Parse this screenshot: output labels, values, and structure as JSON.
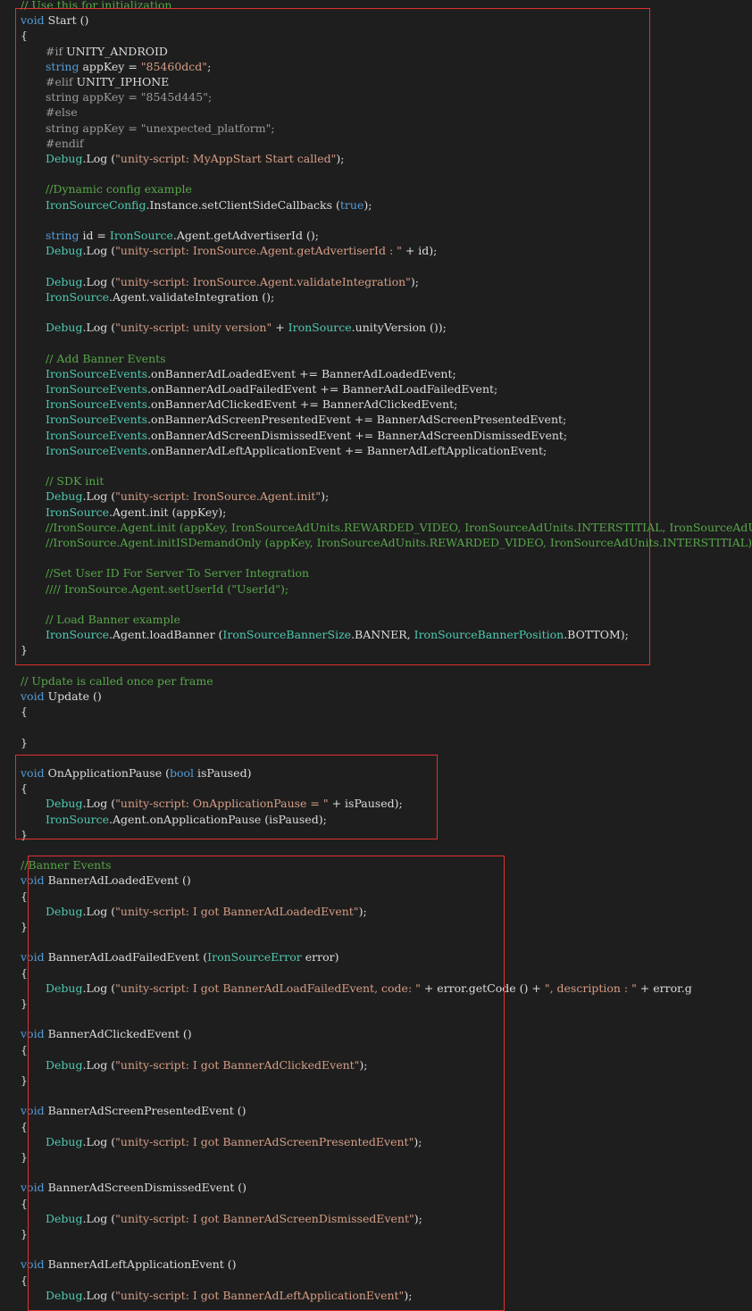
{
  "editor": {
    "colors": {
      "background": "#1e1e1e",
      "keyword": "#569cd6",
      "type": "#4ec9b0",
      "string": "#d69d85",
      "comment": "#57a64a",
      "preprocessor": "#9b9b9b",
      "text": "#dcdcdc",
      "highlight_box": "#e0312f"
    },
    "lines": [
      [
        [
          "cm",
          "// Use this for initialization"
        ]
      ],
      [
        [
          "kw",
          "void"
        ],
        [
          "pl",
          " Start ()"
        ]
      ],
      [
        [
          "pl",
          "{"
        ]
      ],
      [
        [
          "pp",
          "#if"
        ],
        [
          "pl",
          " UNITY_ANDROID"
        ]
      ],
      [
        [
          "kw",
          "string"
        ],
        [
          "pl",
          " appKey = "
        ],
        [
          "str",
          "\"85460dcd\""
        ],
        [
          "pl",
          ";"
        ]
      ],
      [
        [
          "pp",
          "#elif"
        ],
        [
          "pl",
          " UNITY_IPHONE"
        ]
      ],
      [
        [
          "pp",
          "string appKey = \"8545d445\";"
        ]
      ],
      [
        [
          "pp",
          "#else"
        ]
      ],
      [
        [
          "pp",
          "string appKey = \"unexpected_platform\";"
        ]
      ],
      [
        [
          "pp",
          "#endif"
        ]
      ],
      [
        [
          "ty",
          "Debug"
        ],
        [
          "pl",
          ".Log ("
        ],
        [
          "str",
          "\"unity-script: MyAppStart Start called\""
        ],
        [
          "pl",
          ");"
        ]
      ],
      [],
      [
        [
          "cm",
          "//Dynamic config example"
        ]
      ],
      [
        [
          "ty",
          "IronSourceConfig"
        ],
        [
          "pl",
          ".Instance.setClientSideCallbacks ("
        ],
        [
          "kw",
          "true"
        ],
        [
          "pl",
          ");"
        ]
      ],
      [],
      [
        [
          "kw",
          "string"
        ],
        [
          "pl",
          " id = "
        ],
        [
          "ty",
          "IronSource"
        ],
        [
          "pl",
          ".Agent.getAdvertiserId ();"
        ]
      ],
      [
        [
          "ty",
          "Debug"
        ],
        [
          "pl",
          ".Log ("
        ],
        [
          "str",
          "\"unity-script: IronSource.Agent.getAdvertiserId : \""
        ],
        [
          "pl",
          " + id);"
        ]
      ],
      [],
      [
        [
          "ty",
          "Debug"
        ],
        [
          "pl",
          ".Log ("
        ],
        [
          "str",
          "\"unity-script: IronSource.Agent.validateIntegration\""
        ],
        [
          "pl",
          ");"
        ]
      ],
      [
        [
          "ty",
          "IronSource"
        ],
        [
          "pl",
          ".Agent.validateIntegration ();"
        ]
      ],
      [],
      [
        [
          "ty",
          "Debug"
        ],
        [
          "pl",
          ".Log ("
        ],
        [
          "str",
          "\"unity-script: unity version\""
        ],
        [
          "pl",
          " + "
        ],
        [
          "ty",
          "IronSource"
        ],
        [
          "pl",
          ".unityVersion ());"
        ]
      ],
      [],
      [
        [
          "cm",
          "// Add Banner Events"
        ]
      ],
      [
        [
          "ty",
          "IronSourceEvents"
        ],
        [
          "pl",
          ".onBannerAdLoadedEvent += BannerAdLoadedEvent;"
        ]
      ],
      [
        [
          "ty",
          "IronSourceEvents"
        ],
        [
          "pl",
          ".onBannerAdLoadFailedEvent += BannerAdLoadFailedEvent;"
        ]
      ],
      [
        [
          "ty",
          "IronSourceEvents"
        ],
        [
          "pl",
          ".onBannerAdClickedEvent += BannerAdClickedEvent;"
        ]
      ],
      [
        [
          "ty",
          "IronSourceEvents"
        ],
        [
          "pl",
          ".onBannerAdScreenPresentedEvent += BannerAdScreenPresentedEvent;"
        ]
      ],
      [
        [
          "ty",
          "IronSourceEvents"
        ],
        [
          "pl",
          ".onBannerAdScreenDismissedEvent += BannerAdScreenDismissedEvent;"
        ]
      ],
      [
        [
          "ty",
          "IronSourceEvents"
        ],
        [
          "pl",
          ".onBannerAdLeftApplicationEvent += BannerAdLeftApplicationEvent;"
        ]
      ],
      [],
      [
        [
          "cm",
          "// SDK init"
        ]
      ],
      [
        [
          "ty",
          "Debug"
        ],
        [
          "pl",
          ".Log ("
        ],
        [
          "str",
          "\"unity-script: IronSource.Agent.init\""
        ],
        [
          "pl",
          ");"
        ]
      ],
      [
        [
          "ty",
          "IronSource"
        ],
        [
          "pl",
          ".Agent.init (appKey);"
        ]
      ],
      [
        [
          "cm",
          "//IronSource.Agent.init (appKey, IronSourceAdUnits.REWARDED_VIDEO, IronSourceAdUnits.INTERSTITIAL, IronSourceAdUni"
        ]
      ],
      [
        [
          "cm",
          "//IronSource.Agent.initISDemandOnly (appKey, IronSourceAdUnits.REWARDED_VIDEO, IronSourceAdUnits.INTERSTITIAL);"
        ]
      ],
      [],
      [
        [
          "cm",
          "//Set User ID For Server To Server Integration"
        ]
      ],
      [
        [
          "cm",
          "//// IronSource.Agent.setUserId (\"UserId\");"
        ]
      ],
      [],
      [
        [
          "cm",
          "// Load Banner example"
        ]
      ],
      [
        [
          "ty",
          "IronSource"
        ],
        [
          "pl",
          ".Agent.loadBanner ("
        ],
        [
          "ty",
          "IronSourceBannerSize"
        ],
        [
          "pl",
          ".BANNER, "
        ],
        [
          "ty",
          "IronSourceBannerPosition"
        ],
        [
          "pl",
          ".BOTTOM);"
        ]
      ],
      [
        [
          "pl",
          "}"
        ]
      ],
      [],
      [
        [
          "cm",
          "// Update is called once per frame"
        ]
      ],
      [
        [
          "kw",
          "void"
        ],
        [
          "pl",
          " Update ()"
        ]
      ],
      [
        [
          "pl",
          "{"
        ]
      ],
      [],
      [
        [
          "pl",
          "}"
        ]
      ],
      [],
      [
        [
          "kw",
          "void"
        ],
        [
          "pl",
          " OnApplicationPause ("
        ],
        [
          "kw",
          "bool"
        ],
        [
          "pl",
          " isPaused)"
        ]
      ],
      [
        [
          "pl",
          "{"
        ]
      ],
      [
        [
          "ty",
          "Debug"
        ],
        [
          "pl",
          ".Log ("
        ],
        [
          "str",
          "\"unity-script: OnApplicationPause = \""
        ],
        [
          "pl",
          " + isPaused);"
        ]
      ],
      [
        [
          "ty",
          "IronSource"
        ],
        [
          "pl",
          ".Agent.onApplicationPause (isPaused);"
        ]
      ],
      [
        [
          "pl",
          "}"
        ]
      ],
      [],
      [
        [
          "cm",
          "//Banner Events"
        ]
      ],
      [
        [
          "kw",
          "void"
        ],
        [
          "pl",
          " BannerAdLoadedEvent ()"
        ]
      ],
      [
        [
          "pl",
          "{"
        ]
      ],
      [
        [
          "ty",
          "Debug"
        ],
        [
          "pl",
          ".Log ("
        ],
        [
          "str",
          "\"unity-script: I got BannerAdLoadedEvent\""
        ],
        [
          "pl",
          ");"
        ]
      ],
      [
        [
          "pl",
          "}"
        ]
      ],
      [],
      [
        [
          "kw",
          "void"
        ],
        [
          "pl",
          " BannerAdLoadFailedEvent ("
        ],
        [
          "ty",
          "IronSourceError"
        ],
        [
          "pl",
          " error)"
        ]
      ],
      [
        [
          "pl",
          "{"
        ]
      ],
      [
        [
          "ty",
          "Debug"
        ],
        [
          "pl",
          ".Log ("
        ],
        [
          "str",
          "\"unity-script: I got BannerAdLoadFailedEvent, code: \""
        ],
        [
          "pl",
          " + error.getCode () + "
        ],
        [
          "str",
          "\", description : \""
        ],
        [
          "pl",
          " + error.g"
        ]
      ],
      [
        [
          "pl",
          "}"
        ]
      ],
      [],
      [
        [
          "kw",
          "void"
        ],
        [
          "pl",
          " BannerAdClickedEvent ()"
        ]
      ],
      [
        [
          "pl",
          "{"
        ]
      ],
      [
        [
          "ty",
          "Debug"
        ],
        [
          "pl",
          ".Log ("
        ],
        [
          "str",
          "\"unity-script: I got BannerAdClickedEvent\""
        ],
        [
          "pl",
          ");"
        ]
      ],
      [
        [
          "pl",
          "}"
        ]
      ],
      [],
      [
        [
          "kw",
          "void"
        ],
        [
          "pl",
          " BannerAdScreenPresentedEvent ()"
        ]
      ],
      [
        [
          "pl",
          "{"
        ]
      ],
      [
        [
          "ty",
          "Debug"
        ],
        [
          "pl",
          ".Log ("
        ],
        [
          "str",
          "\"unity-script: I got BannerAdScreenPresentedEvent\""
        ],
        [
          "pl",
          ");"
        ]
      ],
      [
        [
          "pl",
          "}"
        ]
      ],
      [],
      [
        [
          "kw",
          "void"
        ],
        [
          "pl",
          " BannerAdScreenDismissedEvent ()"
        ]
      ],
      [
        [
          "pl",
          "{"
        ]
      ],
      [
        [
          "ty",
          "Debug"
        ],
        [
          "pl",
          ".Log ("
        ],
        [
          "str",
          "\"unity-script: I got BannerAdScreenDismissedEvent\""
        ],
        [
          "pl",
          ");"
        ]
      ],
      [
        [
          "pl",
          "}"
        ]
      ],
      [],
      [
        [
          "kw",
          "void"
        ],
        [
          "pl",
          " BannerAdLeftApplicationEvent ()"
        ]
      ],
      [
        [
          "pl",
          "{"
        ]
      ],
      [
        [
          "ty",
          "Debug"
        ],
        [
          "pl",
          ".Log ("
        ],
        [
          "str",
          "\"unity-script: I got BannerAdLeftApplicationEvent\""
        ],
        [
          "pl",
          ");"
        ]
      ]
    ]
  }
}
